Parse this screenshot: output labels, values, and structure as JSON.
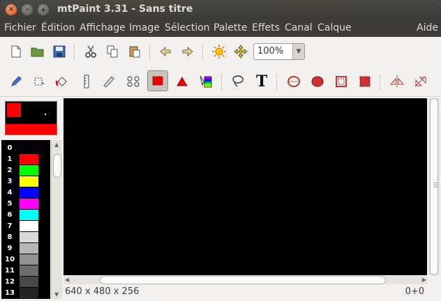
{
  "window": {
    "title": "mtPaint 3.31 - Sans titre"
  },
  "menu": [
    "Fichier",
    "Édition",
    "Affichage",
    "Image",
    "Sélection",
    "Palette",
    "Effets",
    "Canal",
    "Calque",
    "Aide"
  ],
  "toolbar1": {
    "buttons": [
      "new-icon",
      "open-icon",
      "save-icon",
      "cut-icon",
      "copy-icon",
      "paste-icon",
      "undo-icon",
      "redo-icon",
      "brightness-icon",
      "move-icon"
    ],
    "zoom": "100%"
  },
  "toolbar2": {
    "buttons": [
      "pencil-icon",
      "selection-transform-icon",
      "fill-icon",
      "ruler-line-icon",
      "eraser-icon",
      "smudge-icon",
      "brush-icon",
      "gradient-icon",
      "color-picker-icon",
      "lasso-icon",
      "text-icon",
      "ellipse-outline-icon",
      "ellipse-fill-icon",
      "rect-outline-icon",
      "rect-fill-icon",
      "flip-icon",
      "rotate-icon"
    ],
    "pressed": "brush-icon",
    "text_glyph": "T"
  },
  "palette": [
    {
      "index": "0",
      "color": "#000000"
    },
    {
      "index": "1",
      "color": "#ff0000"
    },
    {
      "index": "2",
      "color": "#00ff00"
    },
    {
      "index": "3",
      "color": "#ffff00"
    },
    {
      "index": "4",
      "color": "#0000ff"
    },
    {
      "index": "5",
      "color": "#ff00ff"
    },
    {
      "index": "6",
      "color": "#00ffff"
    },
    {
      "index": "7",
      "color": "#ffffff"
    },
    {
      "index": "8",
      "color": "#d9d9d9"
    },
    {
      "index": "9",
      "color": "#b6b6b6"
    },
    {
      "index": "10",
      "color": "#929292"
    },
    {
      "index": "11",
      "color": "#6d6d6d"
    },
    {
      "index": "12",
      "color": "#494949"
    },
    {
      "index": "13",
      "color": "#242424"
    }
  ],
  "status": {
    "geometry": "640 x 480 x 256",
    "coords": "0+0"
  }
}
